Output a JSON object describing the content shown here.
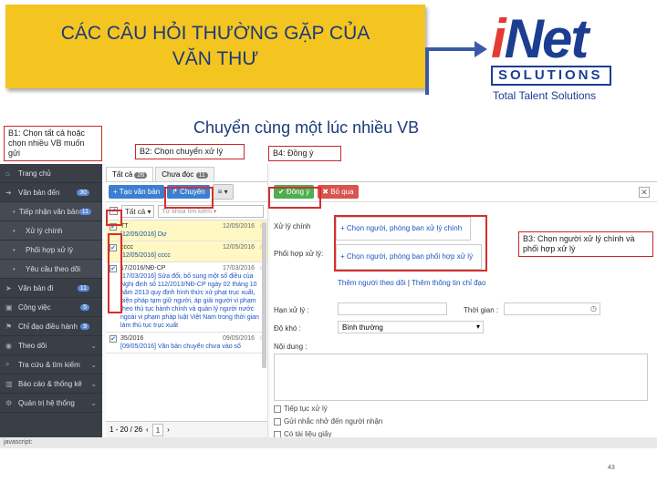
{
  "slide": {
    "title": "CÁC CÂU HỎI THƯỜNG GẶP CỦA\nVĂN THƯ",
    "subtitle": "Chuyển cùng một lúc nhiều VB",
    "page_number": "43",
    "logo": {
      "brand_i": "i",
      "brand_rest": "Net",
      "solutions": "SOLUTIONS",
      "tagline": "Total Talent Solutions"
    },
    "colors": {
      "title_bg": "#f4c520",
      "title_text": "#1c3a7a",
      "accent_red": "#d32f2f",
      "arrow": "#3a5aa8"
    }
  },
  "callouts": {
    "b1": "B1: Chọn tất cả hoặc chọn nhiều VB muốn gửi",
    "b2": "B2: Chọn chuyển xử lý",
    "b3": "B3: Chọn người xử lý chính và phối hợp xử lý",
    "b4": "B4: Đồng ý"
  },
  "sidebar": {
    "items": [
      {
        "label": "Trang chủ",
        "icon": "home-icon",
        "glyph": "⌂"
      },
      {
        "label": "Văn bản đến",
        "icon": "arrow-right-icon",
        "glyph": "➔",
        "badge": "30"
      },
      {
        "label": "Tiếp nhận văn bản",
        "icon": "inbox-icon",
        "glyph": "•",
        "badge": "11",
        "sub": true
      },
      {
        "label": "Xử lý chính",
        "icon": "dot-icon",
        "glyph": "•",
        "sub": true
      },
      {
        "label": "Phối hợp xử lý",
        "icon": "dot-icon",
        "glyph": "•",
        "sub": true
      },
      {
        "label": "Yêu cầu theo dõi",
        "icon": "dot-icon",
        "glyph": "•",
        "sub": true
      },
      {
        "label": "Văn bản đi",
        "icon": "send-icon",
        "glyph": "➤",
        "badge": "11"
      },
      {
        "label": "Công việc",
        "icon": "briefcase-icon",
        "glyph": "▣",
        "badge": "5"
      },
      {
        "label": "Chỉ đạo điều hành",
        "icon": "flag-icon",
        "glyph": "⚑",
        "badge": "9"
      },
      {
        "label": "Theo dõi",
        "icon": "eye-icon",
        "glyph": "◉"
      },
      {
        "label": "Tra cứu & tìm kiếm",
        "icon": "search-icon",
        "glyph": "⌕"
      },
      {
        "label": "Báo cáo & thống kê",
        "icon": "chart-icon",
        "glyph": "▥"
      },
      {
        "label": "Quản trị hệ thống",
        "icon": "gear-icon",
        "glyph": "⚙"
      }
    ],
    "status": "javascript:"
  },
  "list": {
    "tabs": [
      {
        "label": "Tất cả",
        "count": "26"
      },
      {
        "label": "Chưa đọc",
        "count": "11"
      }
    ],
    "toolbar": {
      "new_label": "+ Tạo văn bản",
      "forward_label": "↱ Chuyển",
      "menu_label": "≡ ▾"
    },
    "filter": {
      "select": "Tất cả ▾",
      "search_placeholder": "Từ khóa tìm kiếm ▾"
    },
    "rows": [
      {
        "title": "TT",
        "code": "[12/05/2016] Dự",
        "date": "12/05/2016",
        "checked": true,
        "hl": true
      },
      {
        "title": "cccc",
        "code": "[12/05/2016] cccc",
        "date": "12/05/2016",
        "checked": true,
        "hl": true
      },
      {
        "title": "17/2016/NĐ-CP",
        "code": "[17/03/2016] Sửa đổi, bổ sung một số điều của Nghị định số 112/2013/NĐ-CP ngày 02 tháng 10 năm 2013 quy định hình thức xử phạt trục xuất, biện pháp tạm giữ người, áp giải người vi phạm theo thủ tục hành chính và quản lý người nước ngoài vi phạm pháp luật Việt Nam trong thời gian làm thủ tục trục xuất",
        "date": "17/03/2016",
        "checked": true,
        "hl": false
      },
      {
        "title": "35/2016",
        "code": "[09/05/2016] Văn bản chuyển chưa vào số",
        "date": "09/05/2016",
        "checked": true,
        "hl": false
      }
    ],
    "pager": {
      "range": "1 - 20 / 26",
      "page": "1"
    }
  },
  "detail": {
    "toolbar": {
      "agree_label": "✔ Đồng ý",
      "cancel_label": "✖ Bỏ qua",
      "close": "✕"
    },
    "fields": {
      "main_label": "Xử lý chính",
      "main_link": "+ Chọn người, phòng ban xử lý chính",
      "coop_label": "Phối hợp xử lý:",
      "coop_link": "+ Chọn người, phòng ban phối hợp xử lý",
      "watch_link": "Thêm người theo dõi",
      "sep": "|",
      "notify_link": "Thêm thông tin chỉ đạo",
      "deadline_label": "Hạn xử lý :",
      "time_label": "Thời gian :",
      "difficulty_label": "Độ khó :",
      "difficulty_value": "Bình thường",
      "content_label": "Nội dung :"
    },
    "checks": [
      "Tiếp tục xử lý",
      "Gửi nhắc nhở đến người nhận",
      "Có tài liệu giấy"
    ]
  }
}
